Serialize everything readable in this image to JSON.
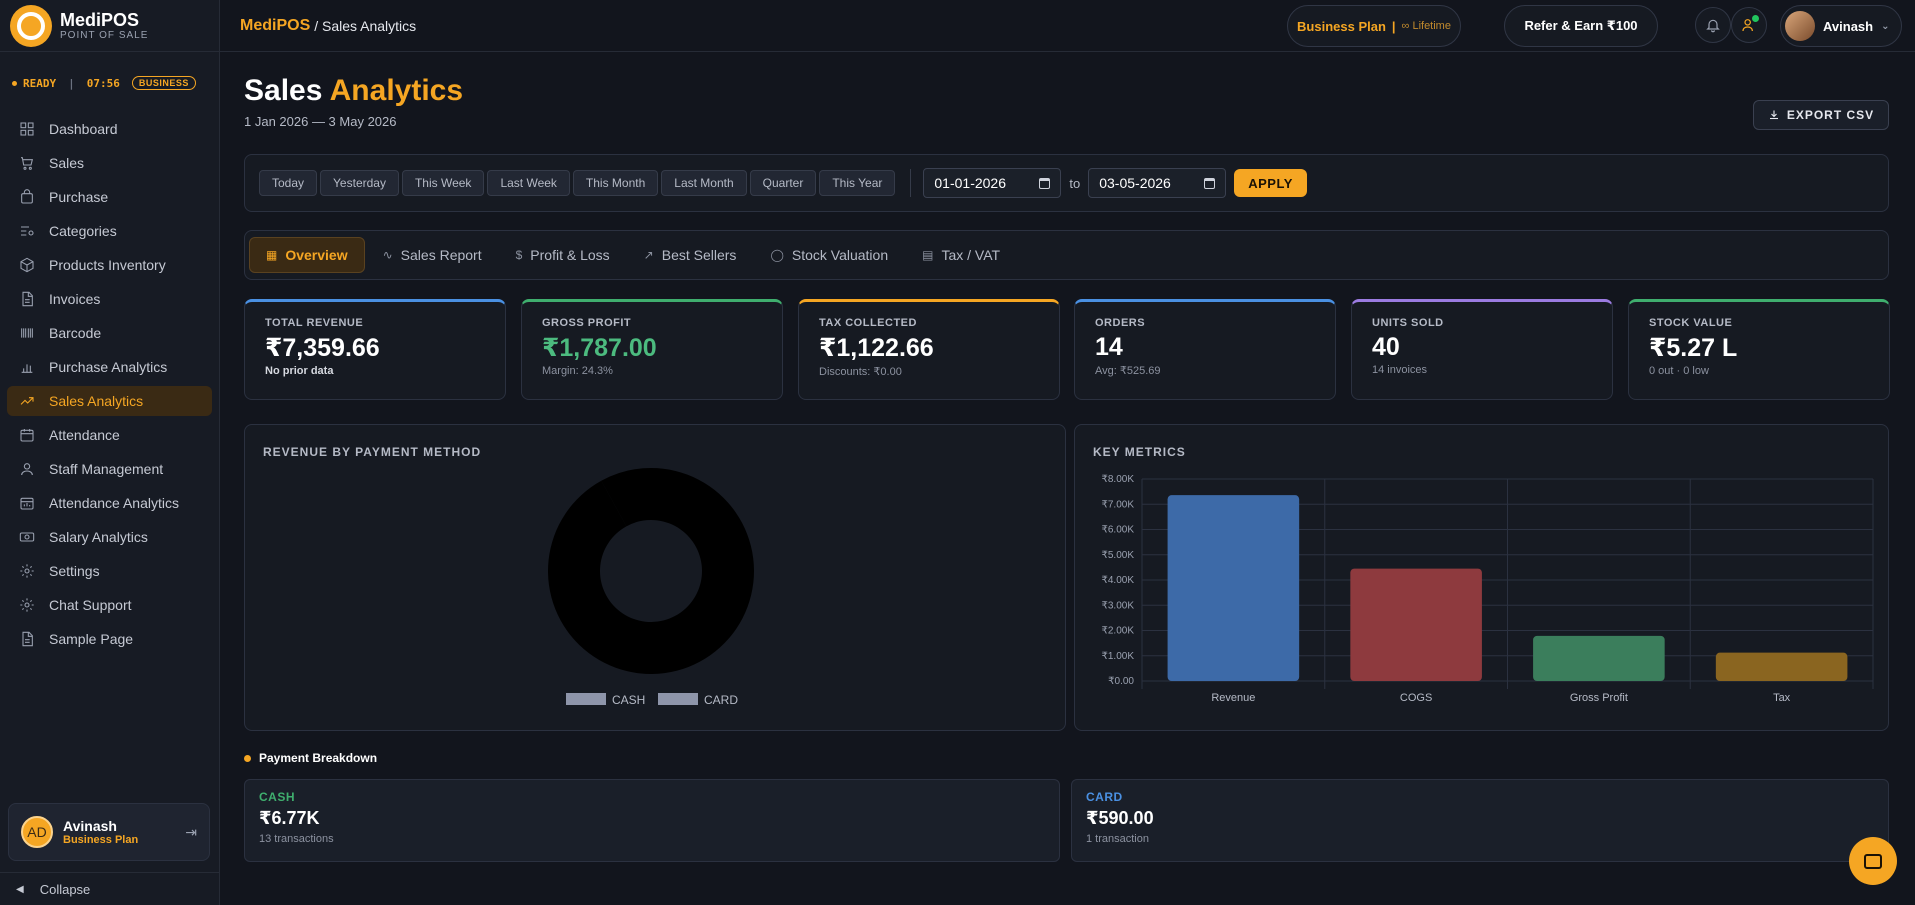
{
  "brand": {
    "name": "MediPOS",
    "subtitle": "POINT OF SALE"
  },
  "status": {
    "state": "READY",
    "time": "07:56",
    "badge": "BUSINESS"
  },
  "sidebar": {
    "items": [
      {
        "label": "Dashboard",
        "icon": "grid-icon"
      },
      {
        "label": "Sales",
        "icon": "cart-icon"
      },
      {
        "label": "Purchase",
        "icon": "bag-icon"
      },
      {
        "label": "Categories",
        "icon": "list-filter-icon"
      },
      {
        "label": "Products Inventory",
        "icon": "box-icon"
      },
      {
        "label": "Invoices",
        "icon": "document-icon"
      },
      {
        "label": "Barcode",
        "icon": "barcode-icon"
      },
      {
        "label": "Purchase Analytics",
        "icon": "bar-chart-icon"
      },
      {
        "label": "Sales Analytics",
        "icon": "trend-up-icon",
        "active": true
      },
      {
        "label": "Attendance",
        "icon": "calendar-icon"
      },
      {
        "label": "Staff Management",
        "icon": "user-icon"
      },
      {
        "label": "Attendance Analytics",
        "icon": "calendar-chart-icon"
      },
      {
        "label": "Salary Analytics",
        "icon": "money-icon"
      },
      {
        "label": "Settings",
        "icon": "gear-icon"
      },
      {
        "label": "Chat Support",
        "icon": "gear-icon"
      },
      {
        "label": "Sample Page",
        "icon": "document-icon"
      }
    ],
    "user": {
      "initials": "AD",
      "name": "Avinash",
      "plan": "Business Plan"
    },
    "collapse_label": "Collapse"
  },
  "topbar": {
    "breadcrumb_brand": "MediPOS",
    "breadcrumb_page": "/ Sales Analytics",
    "plan_label": "Business Plan",
    "plan_sep": "|",
    "plan_term": "∞ Lifetime",
    "refer_label": "Refer & Earn ₹100",
    "user_name": "Avinash"
  },
  "page": {
    "title_main": "Sales",
    "title_highlight": "Analytics",
    "date_range": "1 Jan 2026 — 3 May 2026",
    "export_label": "EXPORT CSV"
  },
  "filters": {
    "quick": [
      "Today",
      "Yesterday",
      "This Week",
      "Last Week",
      "This Month",
      "Last Month",
      "Quarter",
      "This Year"
    ],
    "from_date": "01-01-2026",
    "to_label": "to",
    "to_date": "03-05-2026",
    "apply_label": "APPLY"
  },
  "tabs": [
    {
      "label": "Overview",
      "icon": "grid-icon",
      "active": true
    },
    {
      "label": "Sales Report",
      "icon": "pulse-icon"
    },
    {
      "label": "Profit & Loss",
      "icon": "dollar-icon"
    },
    {
      "label": "Best Sellers",
      "icon": "trend-up-icon"
    },
    {
      "label": "Stock Valuation",
      "icon": "circle-icon"
    },
    {
      "label": "Tax / VAT",
      "icon": "document-icon"
    }
  ],
  "kpis": [
    {
      "label": "TOTAL REVENUE",
      "value": "₹7,359.66",
      "sub": "No prior data",
      "accent": "#4a90e2",
      "value_color": "#ffffff"
    },
    {
      "label": "GROSS PROFIT",
      "value": "₹1,787.00",
      "sub": "Margin: 24.3%",
      "accent": "#3fae6e",
      "value_color": "#4cbb7f"
    },
    {
      "label": "TAX COLLECTED",
      "value": "₹1,122.66",
      "sub": "Discounts: ₹0.00",
      "accent": "#f5a623",
      "value_color": "#ffffff"
    },
    {
      "label": "ORDERS",
      "value": "14",
      "sub": "Avg: ₹525.69",
      "accent": "#4a90e2",
      "value_color": "#ffffff"
    },
    {
      "label": "UNITS SOLD",
      "value": "40",
      "sub": "14 invoices",
      "accent": "#9b7be0",
      "value_color": "#ffffff"
    },
    {
      "label": "STOCK VALUE",
      "value": "₹5.27 L",
      "sub": "0 out · 0 low",
      "accent": "#3fae6e",
      "value_color": "#ffffff"
    }
  ],
  "revenue_panel": {
    "title": "REVENUE BY PAYMENT METHOD"
  },
  "metrics_panel": {
    "title": "KEY METRICS"
  },
  "chart_data": [
    {
      "type": "pie",
      "title": "REVENUE BY PAYMENT METHOD",
      "categories": [
        "CASH",
        "CARD"
      ],
      "values": [
        6770,
        590
      ],
      "legend": "bottom"
    },
    {
      "type": "bar",
      "title": "KEY METRICS",
      "categories": [
        "Revenue",
        "COGS",
        "Gross Profit",
        "Tax"
      ],
      "values": [
        7359.66,
        4450,
        1787,
        1122.66
      ],
      "colors": [
        "#3d6aa8",
        "#8e3a3e",
        "#3b7e5c",
        "#8a6520"
      ],
      "ylim": [
        0,
        8000
      ],
      "yticks": [
        "₹0.00",
        "₹1.00K",
        "₹2.00K",
        "₹3.00K",
        "₹4.00K",
        "₹5.00K",
        "₹6.00K",
        "₹7.00K",
        "₹8.00K"
      ],
      "grid": true
    }
  ],
  "breakdown": {
    "title": "Payment Breakdown",
    "cards": [
      {
        "name": "CASH",
        "value": "₹6.77K",
        "sub": "13 transactions",
        "color": "#3fae6e"
      },
      {
        "name": "CARD",
        "value": "₹590.00",
        "sub": "1 transaction",
        "color": "#4a90e2"
      }
    ]
  }
}
